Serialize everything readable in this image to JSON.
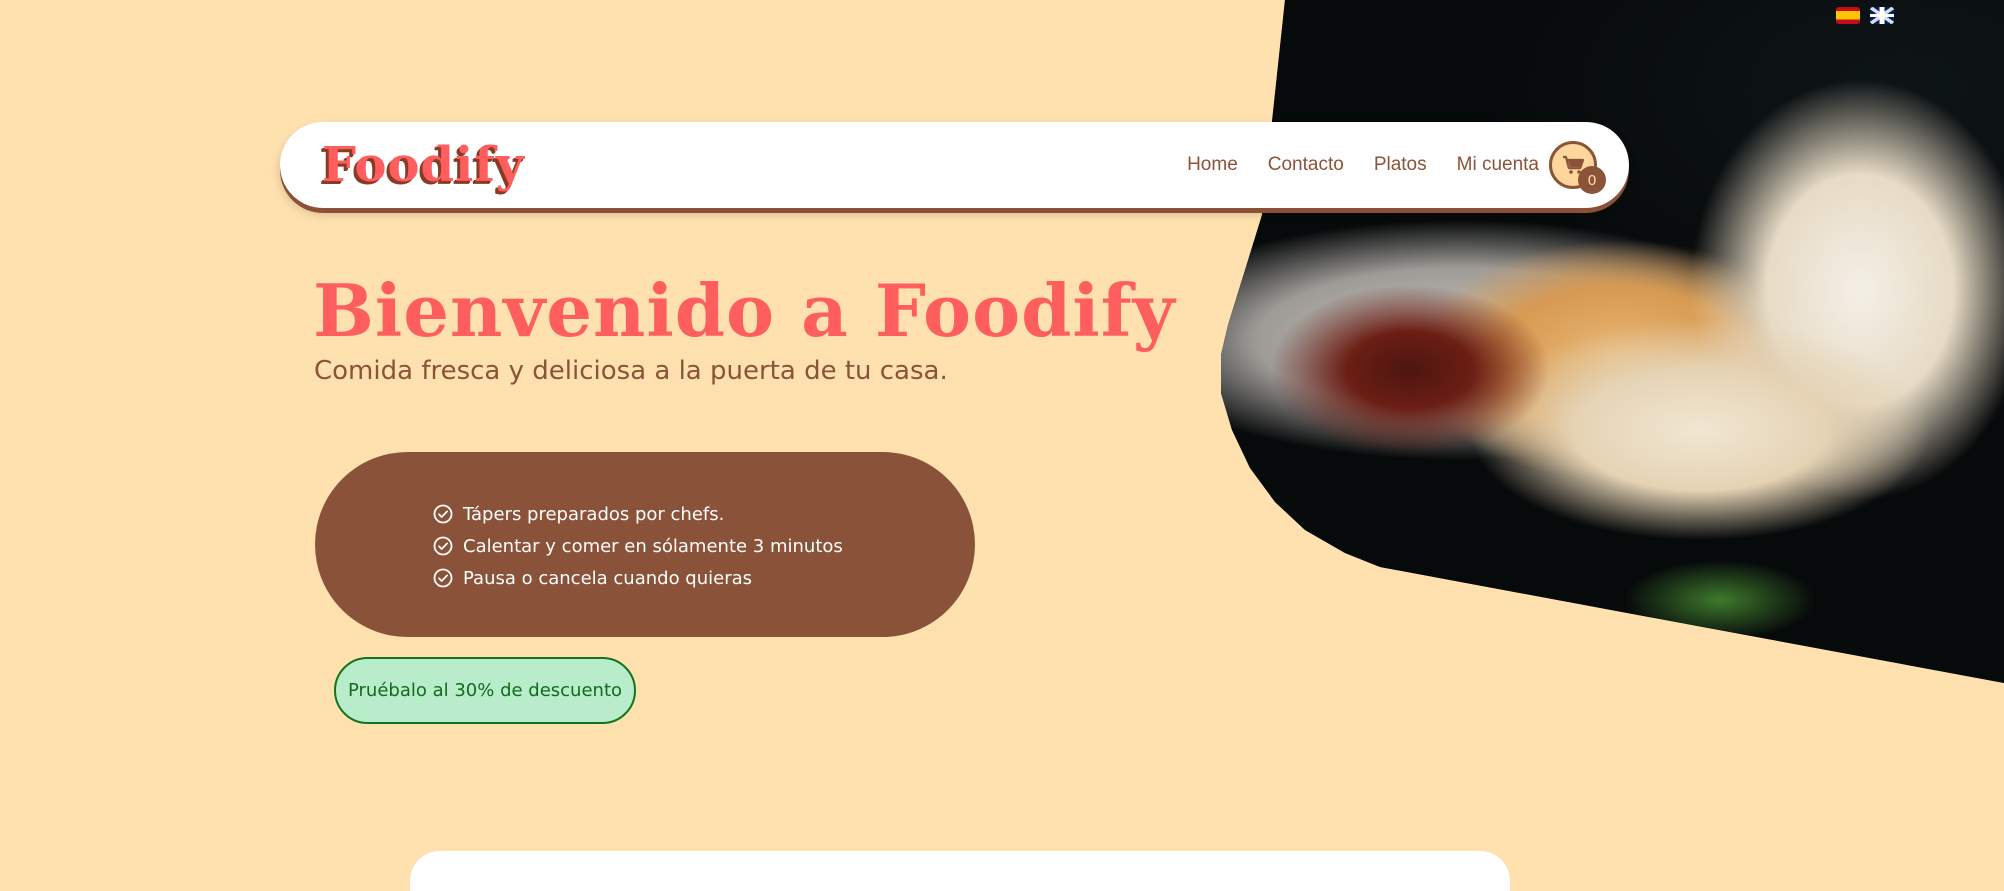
{
  "languages": [
    {
      "code": "es",
      "icon": "spain-flag-icon"
    },
    {
      "code": "en",
      "icon": "uk-flag-icon"
    }
  ],
  "navbar": {
    "logo": "Foodify",
    "links": [
      {
        "label": "Home"
      },
      {
        "label": "Contacto"
      },
      {
        "label": "Platos"
      },
      {
        "label": "Mi cuenta"
      }
    ],
    "cart": {
      "icon": "shopping-cart-icon",
      "count": "0"
    }
  },
  "hero": {
    "title": "Bienvenido a Foodify",
    "subtitle": "Comida fresca y deliciosa a la puerta de tu casa.",
    "features": [
      "Tápers preparados por chefs.",
      "Calentar y comer en sólamente 3 minutos",
      "Pausa o cancela cuando quieras"
    ],
    "cta_label": "Pruébalo al 30% de descuento"
  },
  "colors": {
    "background": "#fee1ae",
    "brand": "#fe5e5e",
    "brown": "#8a5239",
    "cta_bg": "#b8ecca",
    "cta_border": "#14731f"
  }
}
